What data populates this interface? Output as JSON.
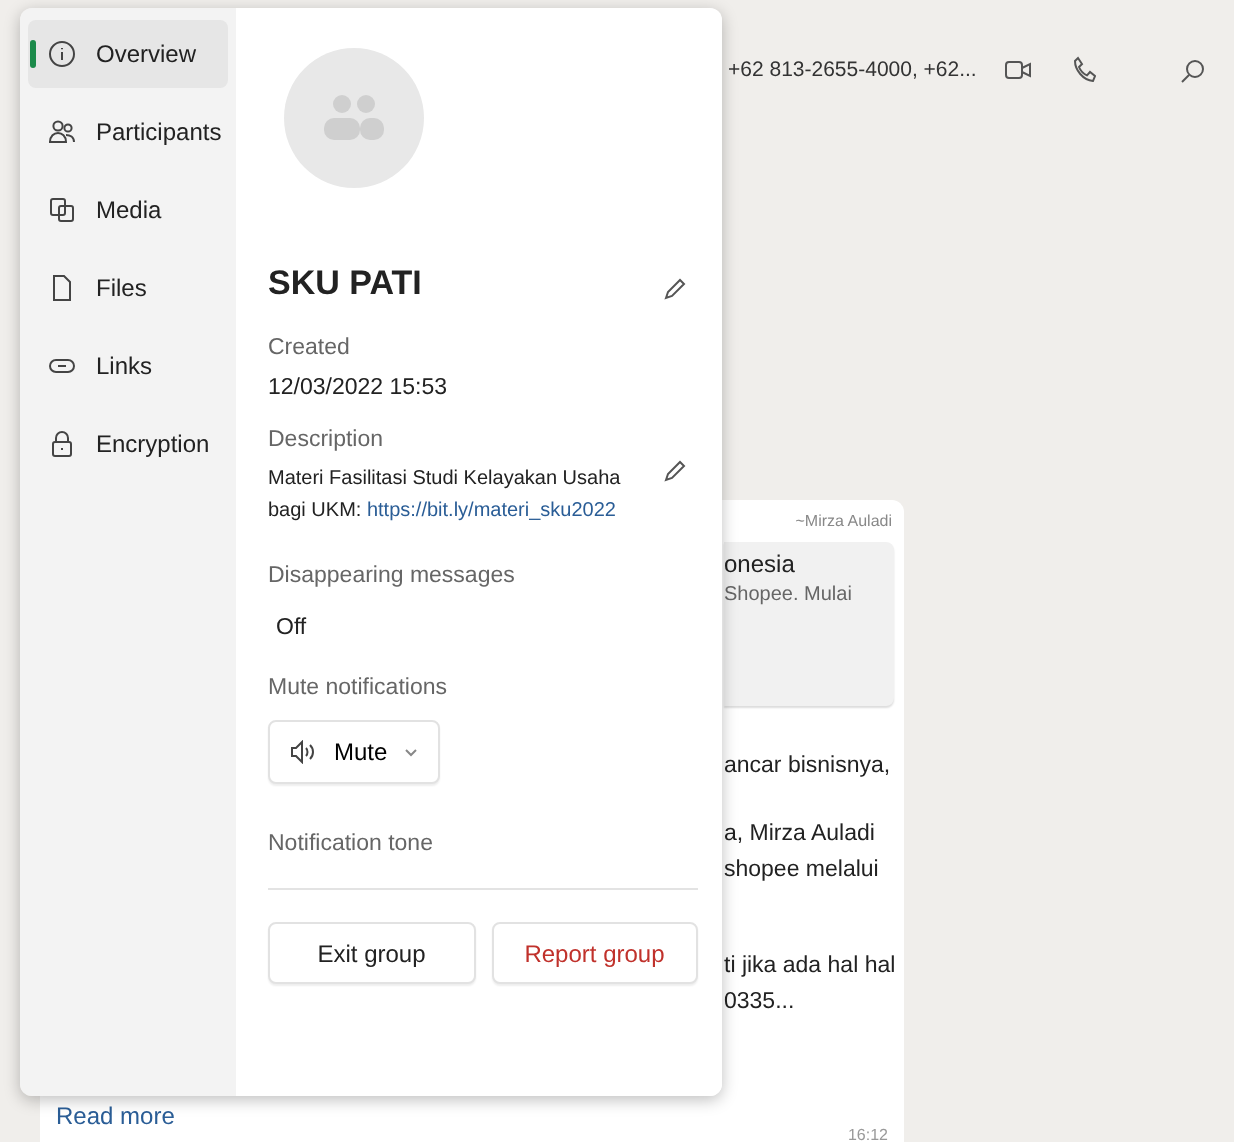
{
  "chat_header": {
    "participants": "+62 813-2655-4000, +62..."
  },
  "message": {
    "sender": "~Mirza Auladi",
    "quote_lines": [
      "onesia",
      "Shopee. Mulai"
    ],
    "lines": [
      "ancar bisnisnya,",
      "a, Mirza Auladi",
      "shopee melalui",
      "ti jika ada hal hal",
      "0335..."
    ],
    "read_more": "Read more",
    "time": "16:12"
  },
  "info_panel": {
    "nav": [
      {
        "label": "Overview",
        "kind": "info",
        "selected": true
      },
      {
        "label": "Participants",
        "kind": "people",
        "selected": false
      },
      {
        "label": "Media",
        "kind": "media",
        "selected": false
      },
      {
        "label": "Files",
        "kind": "file",
        "selected": false
      },
      {
        "label": "Links",
        "kind": "link",
        "selected": false
      },
      {
        "label": "Encryption",
        "kind": "lock",
        "selected": false
      }
    ],
    "group_name": "SKU PATI",
    "created_label": "Created",
    "created": "12/03/2022 15:53",
    "description_label": "Description",
    "description": "Materi Fasilitasi Studi Kelayakan Usaha bagi UKM:",
    "description_link": "https://bit.ly/materi_sku2022",
    "disappearing_label": "Disappearing messages",
    "disappearing": "Off",
    "mute_label": "Mute notifications",
    "mute_button": "Mute",
    "tone_label": "Notification tone",
    "exit_button": "Exit group",
    "report_button": "Report group"
  }
}
